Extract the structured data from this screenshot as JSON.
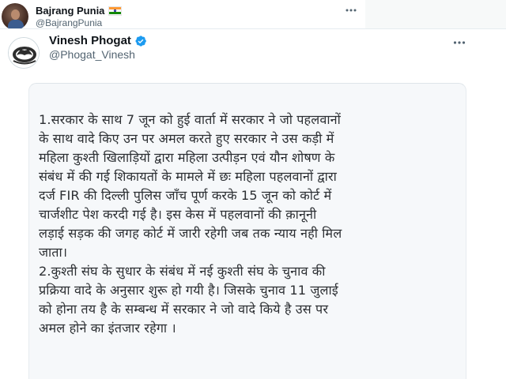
{
  "outer_tweet": {
    "author_name": "Bajrang Punia",
    "author_flag": "indian-flag-icon",
    "author_handle": "@BajrangPunia",
    "more_icon": "more-horizontal-icon"
  },
  "quoted_tweet": {
    "author_name": "Vinesh Phogat",
    "verified_icon": "verified-badge-icon",
    "author_handle": "@Phogat_Vinesh",
    "more_icon": "more-horizontal-icon",
    "statement_lines": [
      "1.सरकार के साथ 7 जून को हुई वार्ता में सरकार ने जो पहलवानों",
      "के साथ वादे किए उन पर अमल करते हुए सरकार ने उस कड़ी में",
      "महिला कुश्ती खिलाड़ियों द्वारा महिला उत्पीड़न एवं यौन शोषण के",
      "संबंध में की गई शिकायतों के मामले में छः महिला पहलवानों द्वारा",
      "दर्ज FIR की दिल्ली पुलिस जाँच पूर्ण करके 15 जून को कोर्ट में",
      "चार्जशीट पेश करदी गई है।  इस केस में पहलवानों की क़ानूनी",
      "लड़ाई सड़क की जगह कोर्ट में जारी रहेगी जब तक न्याय नही मिल",
      "जाता।",
      "2.कुश्ती संघ के सुधार के संबंध में नई कुश्ती संघ के चुनाव की",
      "प्रक्रिया वादे के अनुसार शुरू हो गयी है।  जिसके चुनाव 11 जुलाई",
      "को होना तय है के सम्बन्ध में सरकार ने जो वादे किये है उस पर",
      "अमल होने का इंतजार रहेगा ।"
    ]
  },
  "colors": {
    "primary_text": "#0f1419",
    "secondary_text": "#536471",
    "verified_blue": "#1d9bf0",
    "statement_text": "#2c2f33",
    "statement_background": "#f6f8fa"
  }
}
